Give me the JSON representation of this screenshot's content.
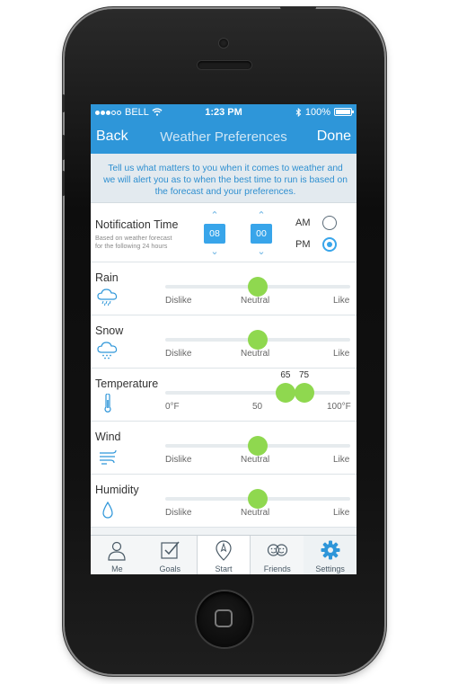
{
  "status_bar": {
    "carrier": "BELL",
    "time": "1:23 PM",
    "battery": "100%"
  },
  "navbar": {
    "back_label": "Back",
    "title": "Weather Preferences",
    "done_label": "Done"
  },
  "intro_text": "Tell us what matters to you when it comes to weather and we will alert you as to when the best time to run is based on the forecast and your preferences.",
  "notification": {
    "title": "Notification Time",
    "subtitle_line1": "Based on weather forecast",
    "subtitle_line2": "for the following 24 hours",
    "hour": "08",
    "minute": "00",
    "am_label": "AM",
    "pm_label": "PM",
    "selected_period": "PM"
  },
  "preferences": [
    {
      "title": "Rain",
      "icon": "rain-cloud-icon",
      "left": "Dislike",
      "middle": "Neutral",
      "right": "Like",
      "value": 0.5
    },
    {
      "title": "Snow",
      "icon": "snow-cloud-icon",
      "left": "Dislike",
      "middle": "Neutral",
      "right": "Like",
      "value": 0.5
    },
    {
      "title": "Temperature",
      "icon": "thermometer-icon",
      "left": "0°F",
      "middle": "50",
      "right": "100°F",
      "range_low": 65,
      "range_high": 75
    },
    {
      "title": "Wind",
      "icon": "wind-icon",
      "left": "Dislike",
      "middle": "Neutral",
      "right": "Like",
      "value": 0.5
    },
    {
      "title": "Humidity",
      "icon": "drop-icon",
      "left": "Dislike",
      "middle": "Neutral",
      "right": "Like",
      "value": 0.5
    }
  ],
  "tabs": [
    {
      "label": "Me",
      "icon": "person-icon"
    },
    {
      "label": "Goals",
      "icon": "checkbox-icon"
    },
    {
      "label": "Start",
      "icon": "compass-pin-icon"
    },
    {
      "label": "Friends",
      "icon": "friends-icon"
    },
    {
      "label": "Settings",
      "icon": "gear-icon"
    }
  ],
  "colors": {
    "accent": "#2e96d9",
    "slider_knob": "#8fd84f"
  }
}
